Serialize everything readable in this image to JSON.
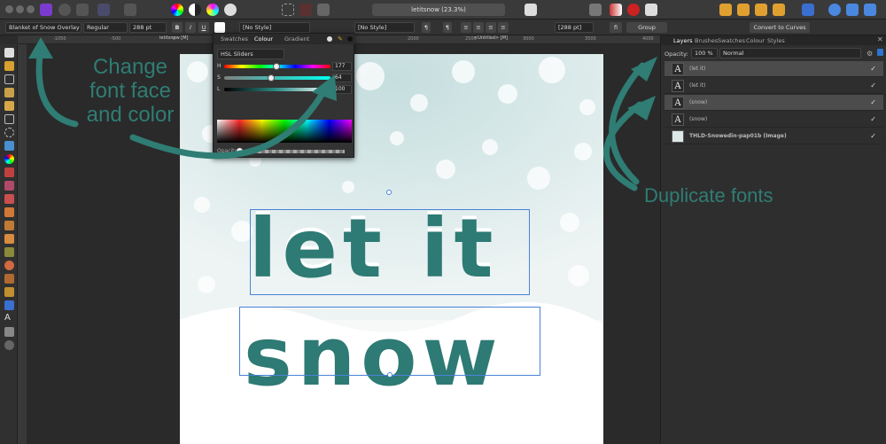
{
  "window": {
    "doc_title": "letitsnow (23.3%)"
  },
  "context_toolbar": {
    "font_family": "Blanket of Snow Overlay",
    "font_style": "Regular",
    "font_size": "288 pt",
    "bold": "B",
    "italic": "I",
    "underline": "U",
    "char_style": "[No Style]",
    "para_style": "[No Style]",
    "size2": "[288 pt]",
    "group_label": "Group",
    "convert_label": "Convert to Curves"
  },
  "ruler": {
    "ticks": [
      "-1050",
      "-500",
      "0",
      "500",
      "1000",
      "1500",
      "2000",
      "2500",
      "3000",
      "3500",
      "4000"
    ]
  },
  "doc_tabs": {
    "left": "letitsnow [M]",
    "right": "<Untitled> [M]"
  },
  "colour_panel": {
    "tabs": [
      "Swatches",
      "Colour",
      "Gradient"
    ],
    "mode": "HSL Sliders",
    "sliders": [
      {
        "label": "H",
        "value": "177",
        "fraction": 0.49
      },
      {
        "label": "S",
        "value": "64",
        "fraction": 0.44
      },
      {
        "label": "L",
        "value": "100",
        "fraction": 0.98
      }
    ],
    "opacity_label": "Opacity"
  },
  "layers_panel": {
    "tabs": [
      "Layers",
      "Brushes",
      "Swatches",
      "Colour",
      "Styles"
    ],
    "opacity_label": "Opacity:",
    "opacity_value": "100 %",
    "blend_mode": "Normal",
    "layers": [
      {
        "thumb": "A",
        "name": "(let it)",
        "selected": true
      },
      {
        "thumb": "A",
        "name": "(let it)",
        "selected": false
      },
      {
        "thumb": "A",
        "name": "(snow)",
        "selected": true
      },
      {
        "thumb": "A",
        "name": "(snow)",
        "selected": false
      },
      {
        "thumb": "",
        "name": "THLD-Snowedin-pap01b (Image)",
        "selected": false
      }
    ]
  },
  "artwork": {
    "line1": "let it",
    "line2": "snow"
  },
  "annotations": {
    "left": [
      "Change",
      "font face",
      "and color"
    ],
    "right": "Duplicate fonts"
  },
  "colors": {
    "accent": "#2f7d74",
    "text_fill": "#2e7a74"
  }
}
